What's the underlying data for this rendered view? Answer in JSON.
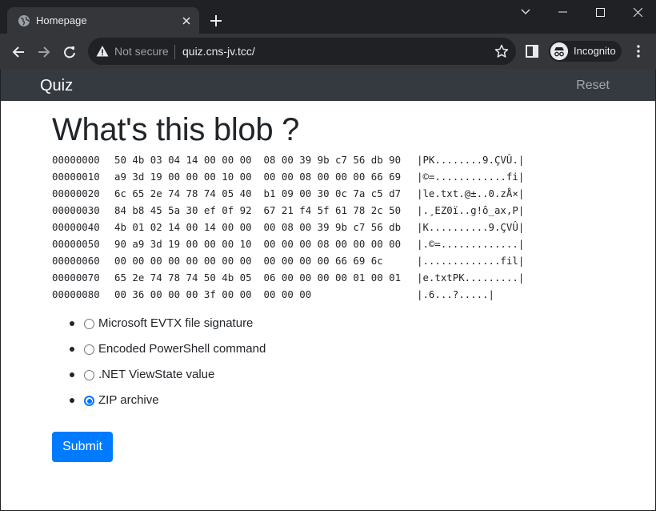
{
  "browser": {
    "tab_title": "Homepage",
    "not_secure": "Not secure",
    "url": "quiz.cns-jv.tcc/",
    "incognito": "Incognito"
  },
  "navbar": {
    "brand": "Quiz",
    "reset": "Reset"
  },
  "page": {
    "title": "What's this blob ?",
    "hexdump": [
      {
        "offset": "00000000",
        "bytes": "50 4b 03 04 14 00 00 00  08 00 39 9b c7 56 db 90",
        "ascii": "|PK........9.ÇVÛ.|"
      },
      {
        "offset": "00000010",
        "bytes": "a9 3d 19 00 00 00 10 00  00 00 08 00 00 00 66 69",
        "ascii": "|©=............fi|"
      },
      {
        "offset": "00000020",
        "bytes": "6c 65 2e 74 78 74 05 40  b1 09 00 30 0c 7a c5 d7",
        "ascii": "|le.txt.@±..0.zÅ×|"
      },
      {
        "offset": "00000030",
        "bytes": "84 b8 45 5a 30 ef 0f 92  67 21 f4 5f 61 78 2c 50",
        "ascii": "|.¸EZ0ï..g!ô_ax,P|"
      },
      {
        "offset": "00000040",
        "bytes": "4b 01 02 14 00 14 00 00  00 08 00 39 9b c7 56 db",
        "ascii": "|K..........9.ÇVÛ|"
      },
      {
        "offset": "00000050",
        "bytes": "90 a9 3d 19 00 00 00 10  00 00 00 08 00 00 00 00",
        "ascii": "|.©=.............|"
      },
      {
        "offset": "00000060",
        "bytes": "00 00 00 00 00 00 00 00  00 00 00 00 66 69 6c",
        "ascii": "|.............fil|"
      },
      {
        "offset": "00000070",
        "bytes": "65 2e 74 78 74 50 4b 05  06 00 00 00 00 01 00 01",
        "ascii": "|e.txtPK.........|"
      },
      {
        "offset": "00000080",
        "bytes": "00 36 00 00 00 3f 00 00  00 00 00",
        "ascii": "|.6...?.....|"
      }
    ],
    "options": [
      {
        "label": "Microsoft EVTX file signature",
        "checked": false
      },
      {
        "label": "Encoded PowerShell command",
        "checked": false
      },
      {
        "label": ".NET ViewState value",
        "checked": false
      },
      {
        "label": "ZIP archive",
        "checked": true
      }
    ],
    "submit_label": "Submit"
  },
  "colors": {
    "primary": "#007bff",
    "navbar": "#343a40",
    "chrome_dark": "#202124",
    "chrome_toolbar": "#35363a"
  }
}
